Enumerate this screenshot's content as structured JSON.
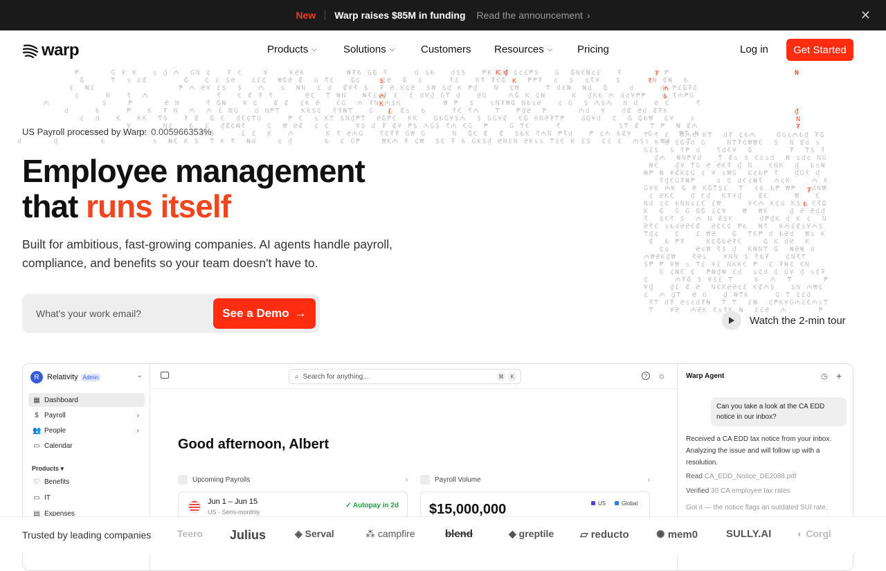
{
  "banner": {
    "badge": "New",
    "headline": "Warp raises $85M in funding",
    "link": "Read the announcement"
  },
  "nav": {
    "logo_text": "warp",
    "items": [
      "Products",
      "Solutions",
      "Customers",
      "Resources",
      "Pricing"
    ],
    "login": "Log in",
    "cta": "Get Started"
  },
  "hero": {
    "stat_label": "US Payroll processed by Warp:",
    "stat_value": "0.005966353%",
    "title_line1": "Employee management",
    "title_line2_prefix": "that ",
    "title_line2_accent": "runs itself",
    "subtitle": "Built for ambitious, fast-growing companies. AI agents handle payroll, compliance, and benefits so your team doesn't have to.",
    "email_placeholder": "What's your work email?",
    "demo_button": "See a Demo",
    "tour_label": "Watch the 2-min tour"
  },
  "app": {
    "workspace": "Relativity",
    "workspace_badge": "Admin",
    "avatar_initial": "R",
    "sidebar": {
      "items": [
        "Dashboard",
        "Payroll",
        "People",
        "Calendar"
      ],
      "section_label": "Products",
      "products": [
        "Benefits",
        "IT",
        "Expenses"
      ]
    },
    "search_placeholder": "Search for anything...",
    "kbd_cmd": "⌘",
    "kbd_k": "K",
    "greeting": "Good afternoon, Albert",
    "upcoming_payrolls": {
      "title": "Upcoming Payrolls",
      "period": "Jun 1 – Jun 15",
      "meta": "US · Semi-monthly",
      "status": "✓ Autopay in 2d"
    },
    "payroll_volume": {
      "title": "Payroll Volume",
      "amount": "$15,000,000",
      "legend": [
        "US",
        "Global"
      ]
    },
    "agent": {
      "title": "Warp Agent",
      "user_message": "Can you take a look at the CA EDD notice in our inbox?",
      "reply": "Received a CA EDD tax notice from your inbox. Analyzing the issue and will follow up with a resolution.",
      "read_label": "Read",
      "read_file": "CA_EDD_Notice_DE2088.pdf",
      "verified_label": "Verified",
      "verified_text": "30 CA employee tax rates",
      "followup": "Got it — the notice flags an outdated SUI rate,"
    }
  },
  "trust": {
    "label": "Trusted by leading companies",
    "logos": [
      "Teero",
      "Julius",
      "Serval",
      "campfire",
      "blend",
      "greptile",
      "reducto",
      "mem0",
      "SULLY.AI",
      "Corgi"
    ]
  },
  "colors": {
    "accent": "#ff2d0f",
    "banner_bg": "#1a1a1a",
    "heading_accent": "#f0451f"
  }
}
